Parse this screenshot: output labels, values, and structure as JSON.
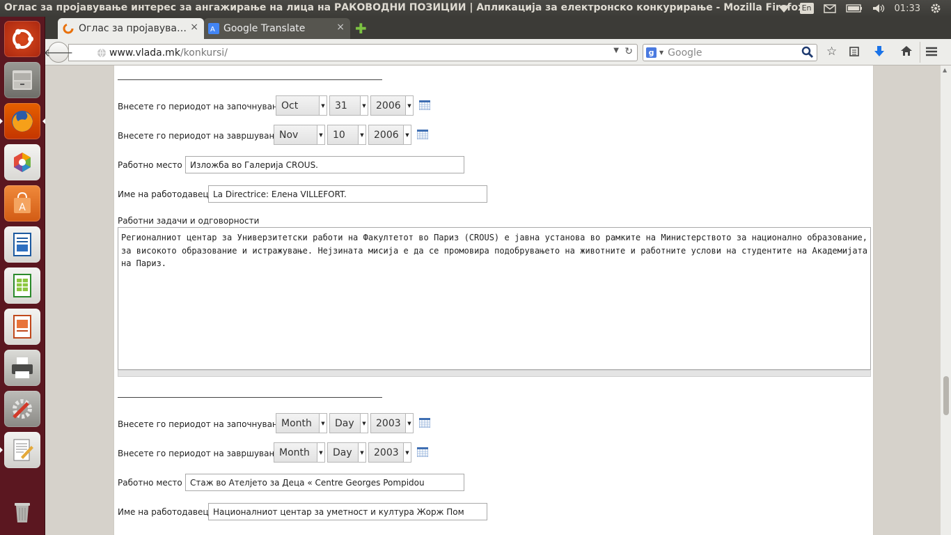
{
  "window": {
    "title": "Оглас за пројавување интерес за ангажирање на лица на РАКОВОДНИ ПОЗИЦИИ | Апликација за електронско конкурирање - Mozilla Firefox"
  },
  "tray": {
    "keyboard": "En",
    "time": "01:33"
  },
  "tabs": [
    {
      "label": "Оглас за пројавува…",
      "close": "×"
    },
    {
      "label": "Google Translate",
      "close": "×"
    }
  ],
  "newtab": "✚",
  "navbar": {
    "url_domain": "www.vlada.mk",
    "url_path": "/konkursi/",
    "search_placeholder": "Google"
  },
  "launcher": {
    "items": [
      "ubuntu-dash",
      "files",
      "firefox",
      "photo-viewer",
      "software-center",
      "writer",
      "calc",
      "impress",
      "printer",
      "system-settings",
      "text-editor",
      "trash"
    ]
  },
  "form": {
    "entry1": {
      "start_label": "Внесете го периодот на започнување:",
      "start_month": "Oct",
      "start_day": "31",
      "start_year": "2006",
      "end_label": "Внесете го периодот на завршување:",
      "end_month": "Nov",
      "end_day": "10",
      "end_year": "2006",
      "workplace_label": "Работно место",
      "workplace_value": "Изложба во Галерија CROUS.",
      "employer_label": "Име на работодавец",
      "employer_value": "La Directrice: Елена VILLEFORT.",
      "duties_label": "Работни задачи и одговорности",
      "duties_value": "Регионалниот центар за Универзитетски работи на Факултетот во Париз (CROUS) е јавна установа во рамките на Министерството за национално образование, за високото образование и истражување. Нејзината мисија е да се промовира подобрувањето на животните и работните услови на студентите на Академијата на Париз."
    },
    "entry2": {
      "start_label": "Внесете го периодот на започнување:",
      "start_month": "Month",
      "start_day": "Day",
      "start_year": "2003",
      "end_label": "Внесете го периодот на завршување:",
      "end_month": "Month",
      "end_day": "Day",
      "end_year": "2003",
      "workplace_label": "Работно место",
      "workplace_value": "Стаж во Ателјето за Деца « Centre Georges Pompidou",
      "employer_label": "Име на работодавец",
      "employer_value": "Националниот центар за уметност и култура Жорж Пом"
    }
  },
  "colors": {
    "launcher": "#5b1720",
    "topbar": "#3c3b37",
    "accent_download": "#1a73e8"
  }
}
